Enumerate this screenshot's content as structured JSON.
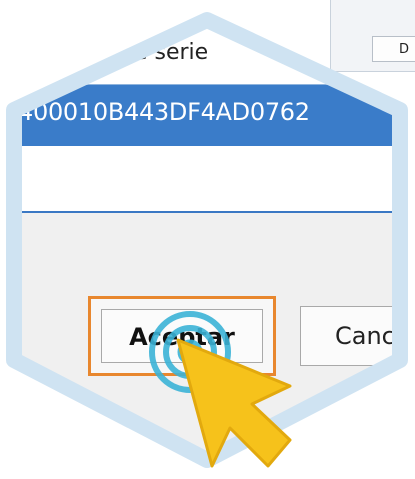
{
  "background_window": {
    "button_label": "D"
  },
  "dialog": {
    "field_label": "de serie",
    "serial_value": "400010B443DF4AD0762",
    "ok_label": "Aceptar",
    "cancel_label": "Cance"
  },
  "icons": {
    "cursor": "click-pointer-icon"
  },
  "colors": {
    "selection": "#3a7cc9",
    "highlight_border": "#e8872e",
    "frame": "#cfe3f2",
    "cursor": "#f6c21b",
    "click_ring": "#3bb3d6"
  }
}
